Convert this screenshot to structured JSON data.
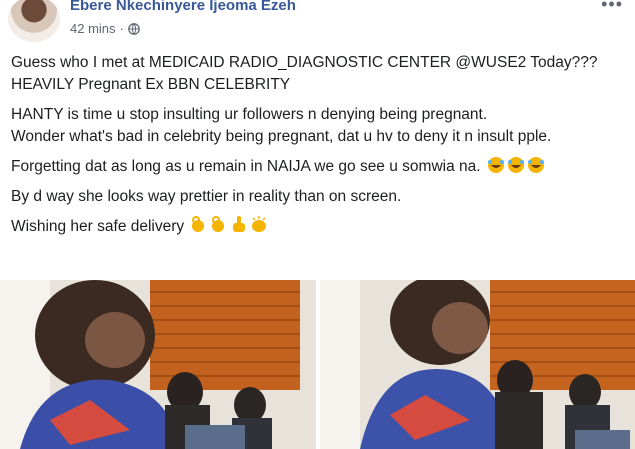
{
  "post": {
    "author": "Ebere Nkechinyere Ijeoma Ezeh",
    "time": "42 mins",
    "separator": "·",
    "more": "•••",
    "lines": {
      "l1": "Guess who I met at MEDICAID RADIO_DIAGNOSTIC CENTER @WUSE2 Today???",
      "l2": "HEAVILY Pregnant Ex BBN CELEBRITY",
      "l3": "HANTY is time u stop insulting ur followers n denying being pregnant.",
      "l4": "Wonder what's bad in celebrity being pregnant, dat u hv to deny it n insult pple.",
      "l5": "Forgetting dat as long as u remain in NAIJA we go see u somwia na.",
      "l6": "By d way she looks way prettier in reality than on screen.",
      "l7": "Wishing her safe delivery"
    },
    "emoji_l5": [
      "laughing-tears-emoji",
      "laughing-tears-emoji",
      "laughing-tears-emoji"
    ],
    "emoji_l7": [
      "ok-hand-emoji",
      "ok-hand-emoji",
      "thumbs-up-emoji",
      "clapping-hands-emoji"
    ]
  },
  "colors": {
    "author": "#385898",
    "meta": "#606770",
    "text": "#1c1e21",
    "emoji": "#f4b400"
  }
}
